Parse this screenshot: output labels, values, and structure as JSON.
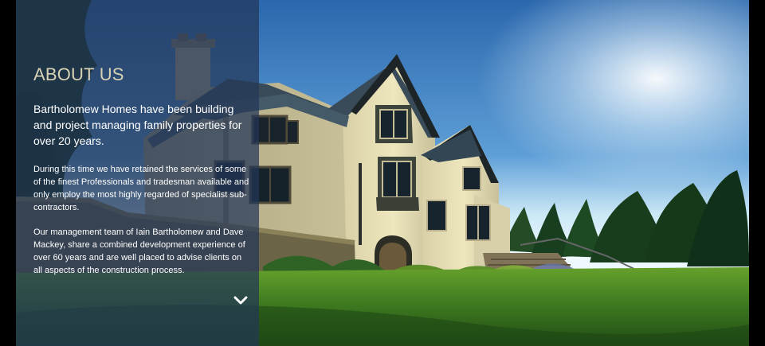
{
  "about": {
    "title": "ABOUT US",
    "intro": "Bartholomew Homes have been building and project managing family properties for over 20 years.",
    "paragraph_1": "During this time we have retained the services of some of the finest Professionals and tradesman available and only employ the most highly regarded of specialist sub-contractors.",
    "paragraph_2": "Our management team of Iain Bartholomew and Dave Mackey, share a combined development experience of over 60 years and are well placed to advise clients on all aspects of the construction process."
  },
  "controls": {
    "scroll_icon": "chevron-down-icon"
  },
  "colors": {
    "panel": "#233658",
    "title": "#d8d2b5",
    "text": "#ffffff",
    "sky": "#5f9fd7",
    "grass": "#2d5c1f"
  }
}
